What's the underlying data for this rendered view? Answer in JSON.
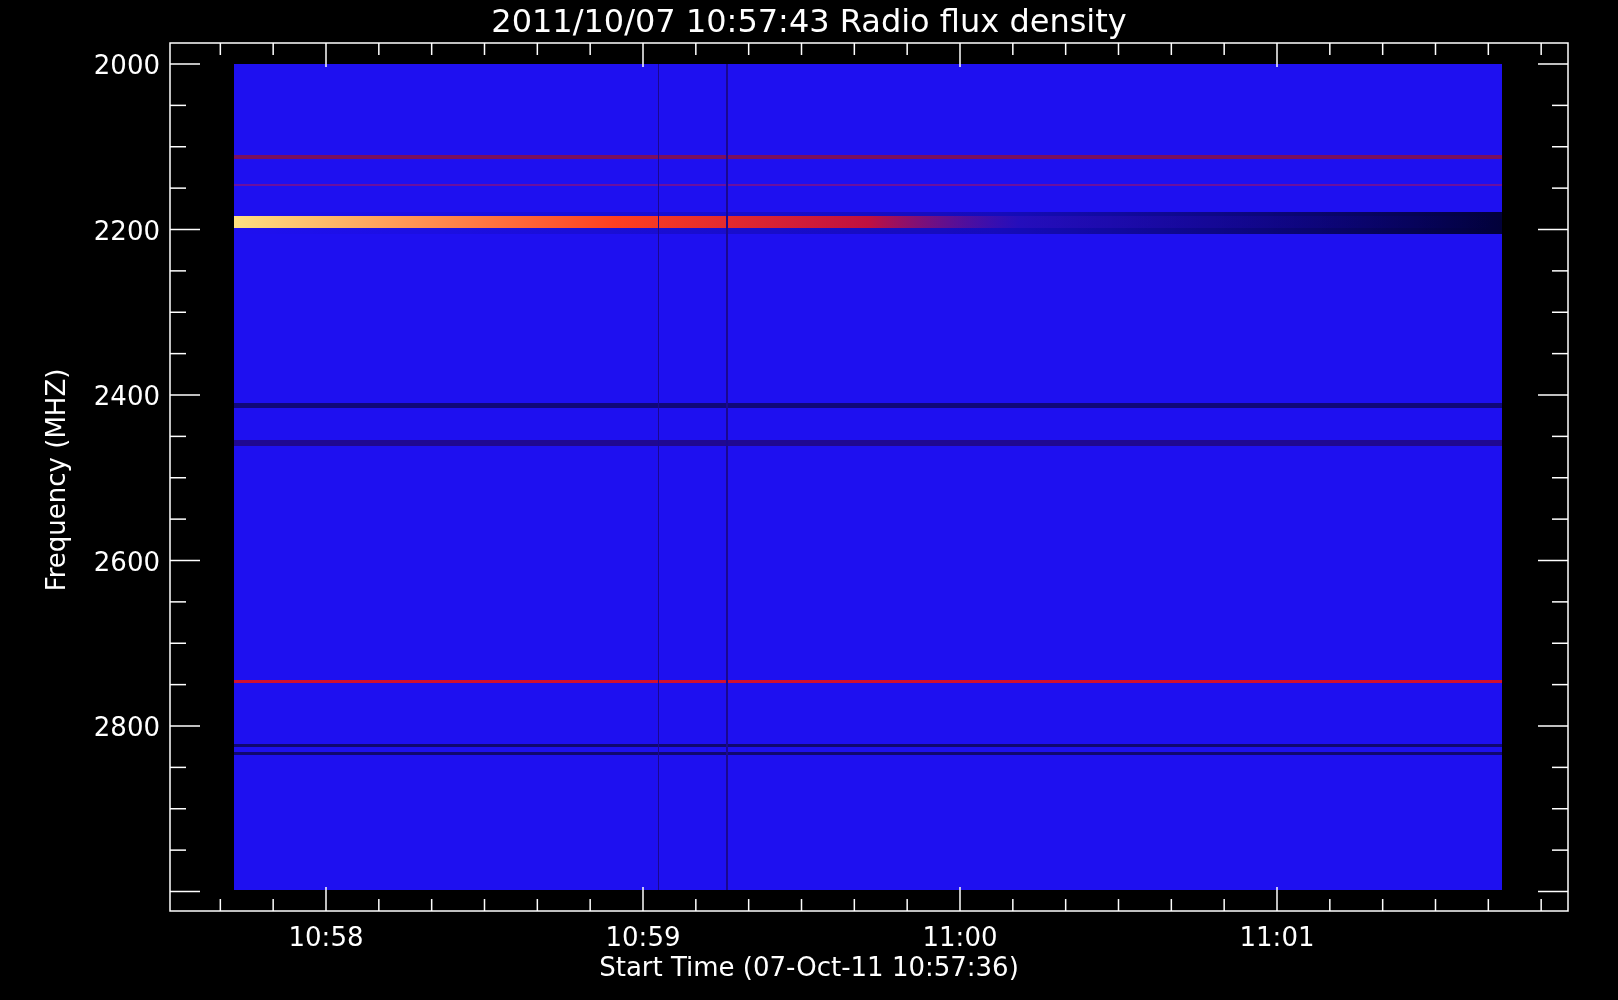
{
  "title": "2011/10/07 10:57:43 Radio flux density",
  "y_axis": {
    "label": "Frequency (MHZ)",
    "ticks": [
      "2000",
      "2200",
      "2400",
      "2600",
      "2800"
    ]
  },
  "x_axis": {
    "label": "Start Time (07-Oct-11 10:57:36)",
    "ticks": [
      "10:58",
      "10:59",
      "11:00",
      "11:01"
    ]
  }
}
